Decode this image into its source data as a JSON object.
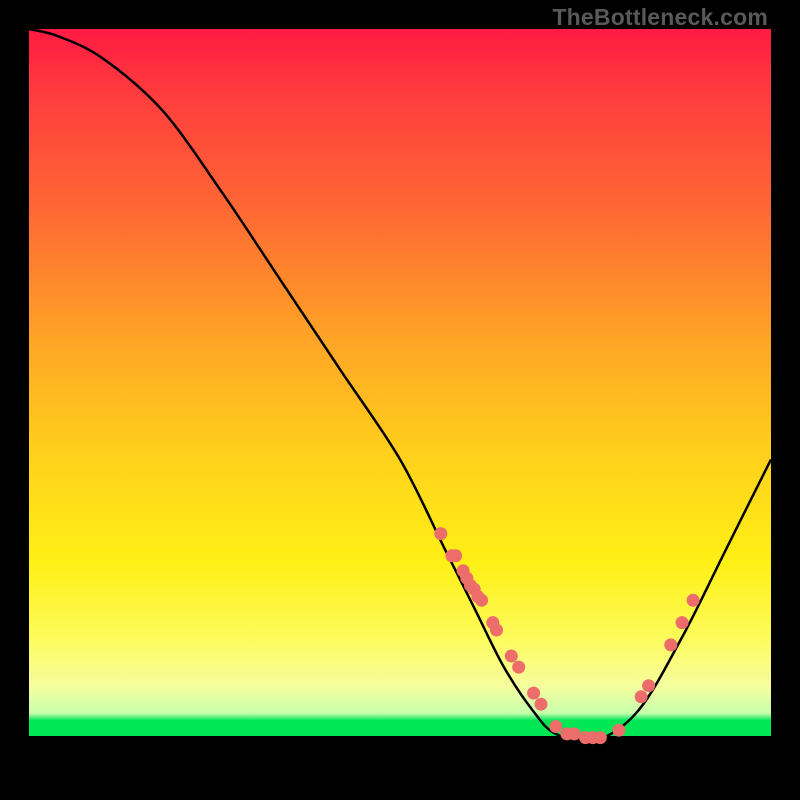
{
  "watermark": "TheBottleneck.com",
  "colors": {
    "curve": "#000000",
    "dots": "#ed6d6b",
    "frame_bg": "#000000"
  },
  "chart_data": {
    "type": "line",
    "title": "",
    "xlabel": "",
    "ylabel": "",
    "xlim": [
      0,
      100
    ],
    "ylim": [
      0,
      100
    ],
    "grid": false,
    "series": [
      {
        "name": "bottleneck-curve",
        "x": [
          0,
          4,
          10,
          18,
          26,
          34,
          42,
          50,
          56,
          60,
          64,
          68,
          71,
          76,
          82,
          88,
          94,
          100
        ],
        "y": [
          100,
          99,
          96,
          89,
          78,
          66,
          54,
          42,
          30,
          22,
          14,
          8,
          5,
          4,
          8,
          18,
          30,
          42
        ]
      }
    ],
    "scatter_points": {
      "name": "sample-dots",
      "x": [
        55.5,
        57,
        57.5,
        58.5,
        59,
        59.5,
        60,
        60.5,
        61,
        62.5,
        63,
        65,
        66,
        68,
        69,
        71,
        72.5,
        73.5,
        75,
        76,
        77,
        79.5,
        82.5,
        83.5,
        86.5,
        88,
        89.5
      ],
      "y": [
        32,
        29,
        29,
        27,
        26,
        25,
        24.5,
        23.5,
        23,
        20,
        19,
        15.5,
        14,
        10.5,
        9,
        6,
        5,
        5,
        4.5,
        4.5,
        4.5,
        5.5,
        10,
        11.5,
        17,
        20,
        23
      ]
    },
    "background_gradient": [
      {
        "stop": 0.0,
        "color": "#ff1a42"
      },
      {
        "stop": 0.45,
        "color": "#ffc220"
      },
      {
        "stop": 0.85,
        "color": "#fbfe7d"
      },
      {
        "stop": 0.94,
        "color": "#00e756"
      },
      {
        "stop": 0.953,
        "color": "#000000"
      }
    ]
  }
}
